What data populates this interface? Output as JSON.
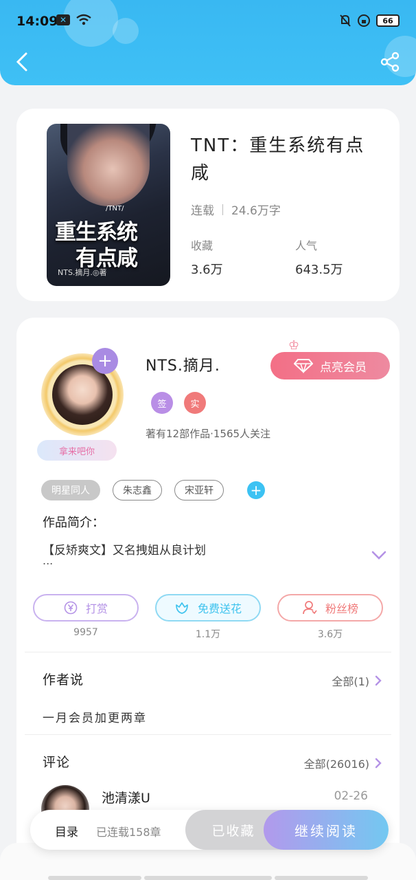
{
  "status_bar": {
    "time": "14:09",
    "battery": "66"
  },
  "book": {
    "title": "TNT：重生系统有点咸",
    "status": "连载",
    "word_count": "24.6万字",
    "collect_label": "收藏",
    "collect_value": "3.6万",
    "popularity_label": "人气",
    "popularity_value": "643.5万",
    "cover": {
      "tag": "/TNT/",
      "title_line1": "重生系统",
      "title_line2": "有点咸",
      "author": "NTS.摘月.◎著"
    }
  },
  "author": {
    "name": "NTS.摘月.",
    "nameplate": "拿来吧你",
    "badge_sign": "签",
    "badge_real": "实",
    "stats": "著有12部作品·1565人关注",
    "vip_button": "点亮会员"
  },
  "tags": [
    "明星同人",
    "朱志鑫",
    "宋亚轩"
  ],
  "intro": {
    "label": "作品简介：",
    "text": "【反矫爽文】又名拽姐从良计划",
    "ellipsis": "..."
  },
  "actions": [
    {
      "label": "打赏",
      "count": "9957",
      "color": "#b492e6"
    },
    {
      "label": "免费送花",
      "count": "1.1万",
      "color": "#3fc3ee"
    },
    {
      "label": "粉丝榜",
      "count": "3.6万",
      "color": "#f07a7a"
    }
  ],
  "author_note": {
    "title": "作者说",
    "more": "全部(1)",
    "text": "一月会员加更两章"
  },
  "comments": {
    "title": "评论",
    "more": "全部(26016)",
    "first": {
      "name": "池清漾U",
      "date": "02-26"
    }
  },
  "bottom_bar": {
    "catalog": "目录",
    "serial": "已连载158章",
    "collected": "已收藏",
    "continue": "继续阅读"
  },
  "colors": {
    "header": "#3fc0f5",
    "accent_purple": "#a98be3",
    "vip": "#f36f86"
  }
}
